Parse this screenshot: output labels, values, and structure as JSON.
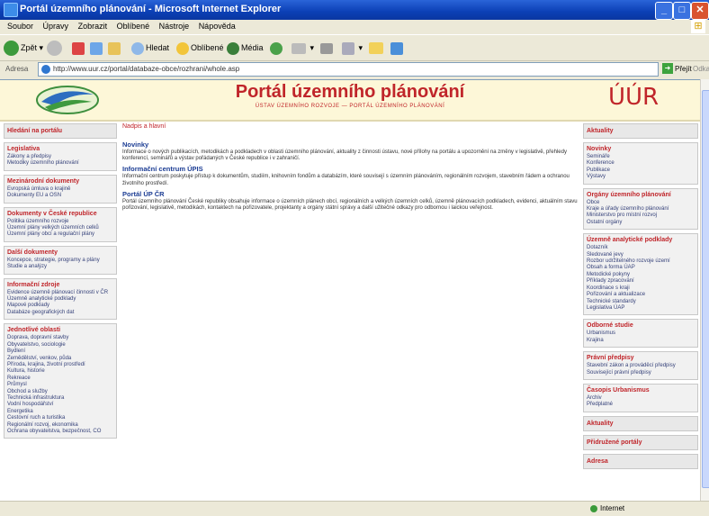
{
  "window": {
    "title": "Portál územního plánování - Microsoft Internet Explorer",
    "buttons": [
      "_",
      "□",
      "✕"
    ]
  },
  "menubar": [
    "Soubor",
    "Úpravy",
    "Zobrazit",
    "Oblíbené",
    "Nástroje",
    "Nápověda"
  ],
  "toolbar": {
    "back": "Zpět",
    "search": "Hledat",
    "favorites": "Oblíbené",
    "media": "Média"
  },
  "address": {
    "label": "Adresa",
    "url": "http://www.uur.cz/portal/databaze-obce/rozhrani/whole.asp",
    "go": "Přejít",
    "links": "Odkazy"
  },
  "site": {
    "title": "Portál územního plánování",
    "subtitle": "ÚSTAV ÚZEMNÍHO ROZVOJE — PORTÁL ÚZEMNÍHO PLÁNOVÁNÍ",
    "logo_right": "ÚÚR",
    "brand_color": "#c0252a"
  },
  "left_sidebar": [
    {
      "title": "Hledání na portálu",
      "links": []
    },
    {
      "title": "Legislativa",
      "links": [
        "Zákony a předpisy",
        "Metodiky územního plánování"
      ]
    },
    {
      "title": "Mezinárodní dokumenty",
      "links": [
        "Evropská úmluva o krajině",
        "Dokumenty EU a OSN"
      ]
    },
    {
      "title": "Dokumenty v České republice",
      "links": [
        "Politika územního rozvoje",
        "Územní plány velkých územních celků",
        "Územní plány obcí a regulační plány"
      ]
    },
    {
      "title": "Další dokumenty",
      "links": [
        "Koncepce, strategie, programy a plány",
        "Studie a analýzy"
      ]
    },
    {
      "title": "Informační zdroje",
      "links": [
        "Evidence územně plánovací činnosti v ČR",
        "Územně analytické podklady",
        "Mapové podklady",
        "Databáze geografických dat"
      ]
    },
    {
      "title": "Jednotlivé oblasti",
      "links": [
        "Doprava, dopravní stavby",
        "Obyvatelstvo, sociologie",
        "Bydlení",
        "Zemědělství, venkov, půda",
        "Příroda, krajina, životní prostředí",
        "Kultura, historie",
        "Rekreace",
        "Průmysl",
        "Obchod a služby",
        "Technická infrastruktura",
        "Vodní hospodářství",
        "Energetika",
        "Cestovní ruch a turistika",
        "Regionální rozvoj, ekonomika",
        "Ochrana obyvatelstva, bezpečnost, CO"
      ]
    }
  ],
  "main": {
    "breadcrumb": "Nadpis a hlavní",
    "sections": [
      {
        "title": "Novinky",
        "text": "Informace o nových publikacích, metodikách a podkladech v oblasti územního plánování, aktuality z činnosti ústavu, nové přílohy na portálu a upozornění na změny v legislativě, přehledy konferencí, seminářů a výstav pořádaných v České republice i v zahraničí."
      },
      {
        "title": "Informační centrum ÚPIS",
        "text": "Informační centrum poskytuje přístup k dokumentům, studiím, knihovním fondům a databázím, které souvisejí s územním plánováním, regionálním rozvojem, stavebním řádem a ochranou životního prostředí."
      },
      {
        "title": "Portál ÚP ČR",
        "text": "Portál územního plánování České republiky obsahuje informace o územních plánech obcí, regionálních a velkých územních celků, územně plánovacích podkladech, evidenci, aktuálním stavu pořizování, legislativě, metodikách, kontaktech na pořizovatele, projektanty a orgány státní správy a další užitečné odkazy pro odbornou i laickou veřejnost."
      }
    ]
  },
  "right_sidebar": [
    {
      "title": "Aktuality",
      "links": []
    },
    {
      "title": "Novinky",
      "links": [
        "Semináře",
        "Konference",
        "Publikace",
        "Výstavy"
      ]
    },
    {
      "title": "Orgány územního plánování",
      "links": [
        "Obce",
        "Kraje a úřady územního plánování",
        "Ministerstvo pro místní rozvoj",
        "Ostatní orgány"
      ]
    },
    {
      "title": "Územně analytické podklady",
      "links": [
        "Dotazník",
        "Sledované jevy",
        "Rozbor udržitelného rozvoje území",
        "Obsah a forma ÚAP",
        "Metodické pokyny",
        "Příklady zpracování",
        "Koordinace s kraji",
        "Pořizování a aktualizace",
        "Technické standardy",
        "Legislativa ÚAP"
      ]
    },
    {
      "title": "Odborné studie",
      "links": [
        "Urbanismus",
        "Krajina"
      ]
    },
    {
      "title": "Právní předpisy",
      "links": [
        "Stavební zákon a prováděcí předpisy",
        "Související právní předpisy"
      ]
    },
    {
      "title": "Časopis Urbanismus",
      "links": [
        "Archiv",
        "Předplatné"
      ]
    },
    {
      "title": "Aktuality",
      "links": []
    },
    {
      "title": "Přidružené portály",
      "links": []
    },
    {
      "title": "Adresa",
      "links": []
    }
  ],
  "status": {
    "zone": "Internet"
  }
}
